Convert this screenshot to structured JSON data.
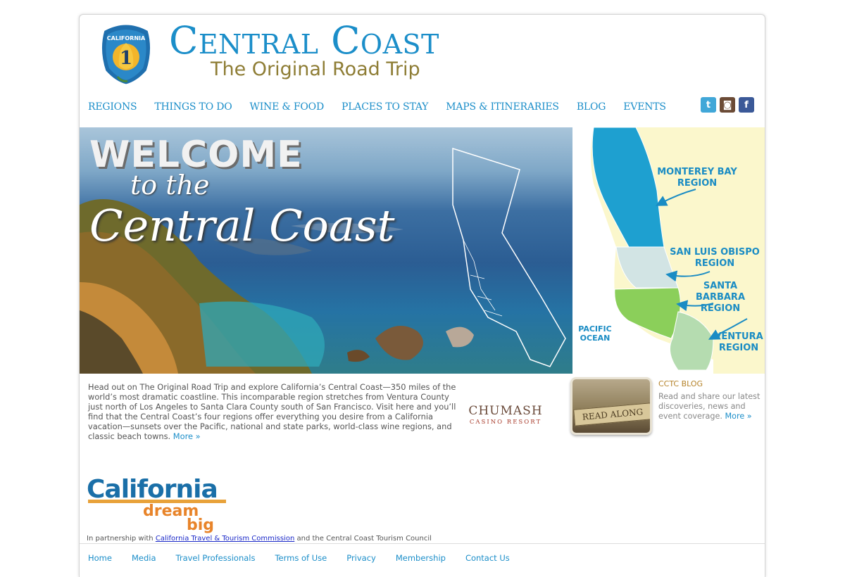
{
  "header": {
    "badge_text": "CALIFORNIA",
    "badge_number": "1",
    "title": "Central Coast",
    "subtitle": "The Original Road Trip"
  },
  "nav": {
    "items": [
      "REGIONS",
      "THINGS TO DO",
      "WINE & FOOD",
      "PLACES TO STAY",
      "MAPS & ITINERARIES",
      "BLOG",
      "EVENTS"
    ]
  },
  "social": {
    "icons": [
      "twitter-icon",
      "instagram-icon",
      "facebook-icon"
    ],
    "twitter_glyph": "t",
    "instagram_glyph": "◙",
    "facebook_glyph": "f"
  },
  "hero": {
    "welcome": "WELCOME",
    "to_the": "to the",
    "central_coast": "Central Coast"
  },
  "region_map": {
    "monterey": "MONTEREY BAY REGION",
    "slo": "SAN LUIS OBISPO REGION",
    "santa_barbara": "SANTA BARBARA REGION",
    "ventura": "VENTURA REGION",
    "pacific": "PACIFIC OCEAN",
    "colors": {
      "monterey": "#1ea0d0",
      "slo": "#d2e4e4",
      "santa_barbara": "#8bcf5a",
      "ventura": "#b5dcb0",
      "land": "#fbf7cc"
    }
  },
  "intro": {
    "text": "Head out on The Original Road Trip and explore California’s Central Coast—350 miles of the world’s most dramatic coastline. This incomparable region stretches from Ventura County just north of Los Angeles to Santa Clara County south of San Francisco. Visit here and you’ll find that the Central Coast’s four regions offer everything you desire from a California vacation—sunsets over the Pacific, national and state parks, world-class wine regions, and classic beach towns.",
    "more": "More »"
  },
  "sponsor": {
    "name": "CHUMASH",
    "tagline": "CASINO RESORT"
  },
  "blog": {
    "read_along": "READ ALONG",
    "title": "CCTC BLOG",
    "description": "Read and share our latest discoveries, news and event coverage.",
    "more": "More »"
  },
  "partners": {
    "logo_line1": "California",
    "logo_line2": "dream",
    "logo_line3": "big",
    "prefix": "In partnership with",
    "link": "California Travel & Tourism Commission",
    "suffix": "and the Central Coast Tourism Council"
  },
  "footer": {
    "links": [
      "Home",
      "Media",
      "Travel Professionals",
      "Terms of Use",
      "Privacy",
      "Membership",
      "Contact Us"
    ]
  },
  "colors": {
    "brand_blue": "#1b8ec9",
    "brand_gold": "#8e7d35"
  }
}
